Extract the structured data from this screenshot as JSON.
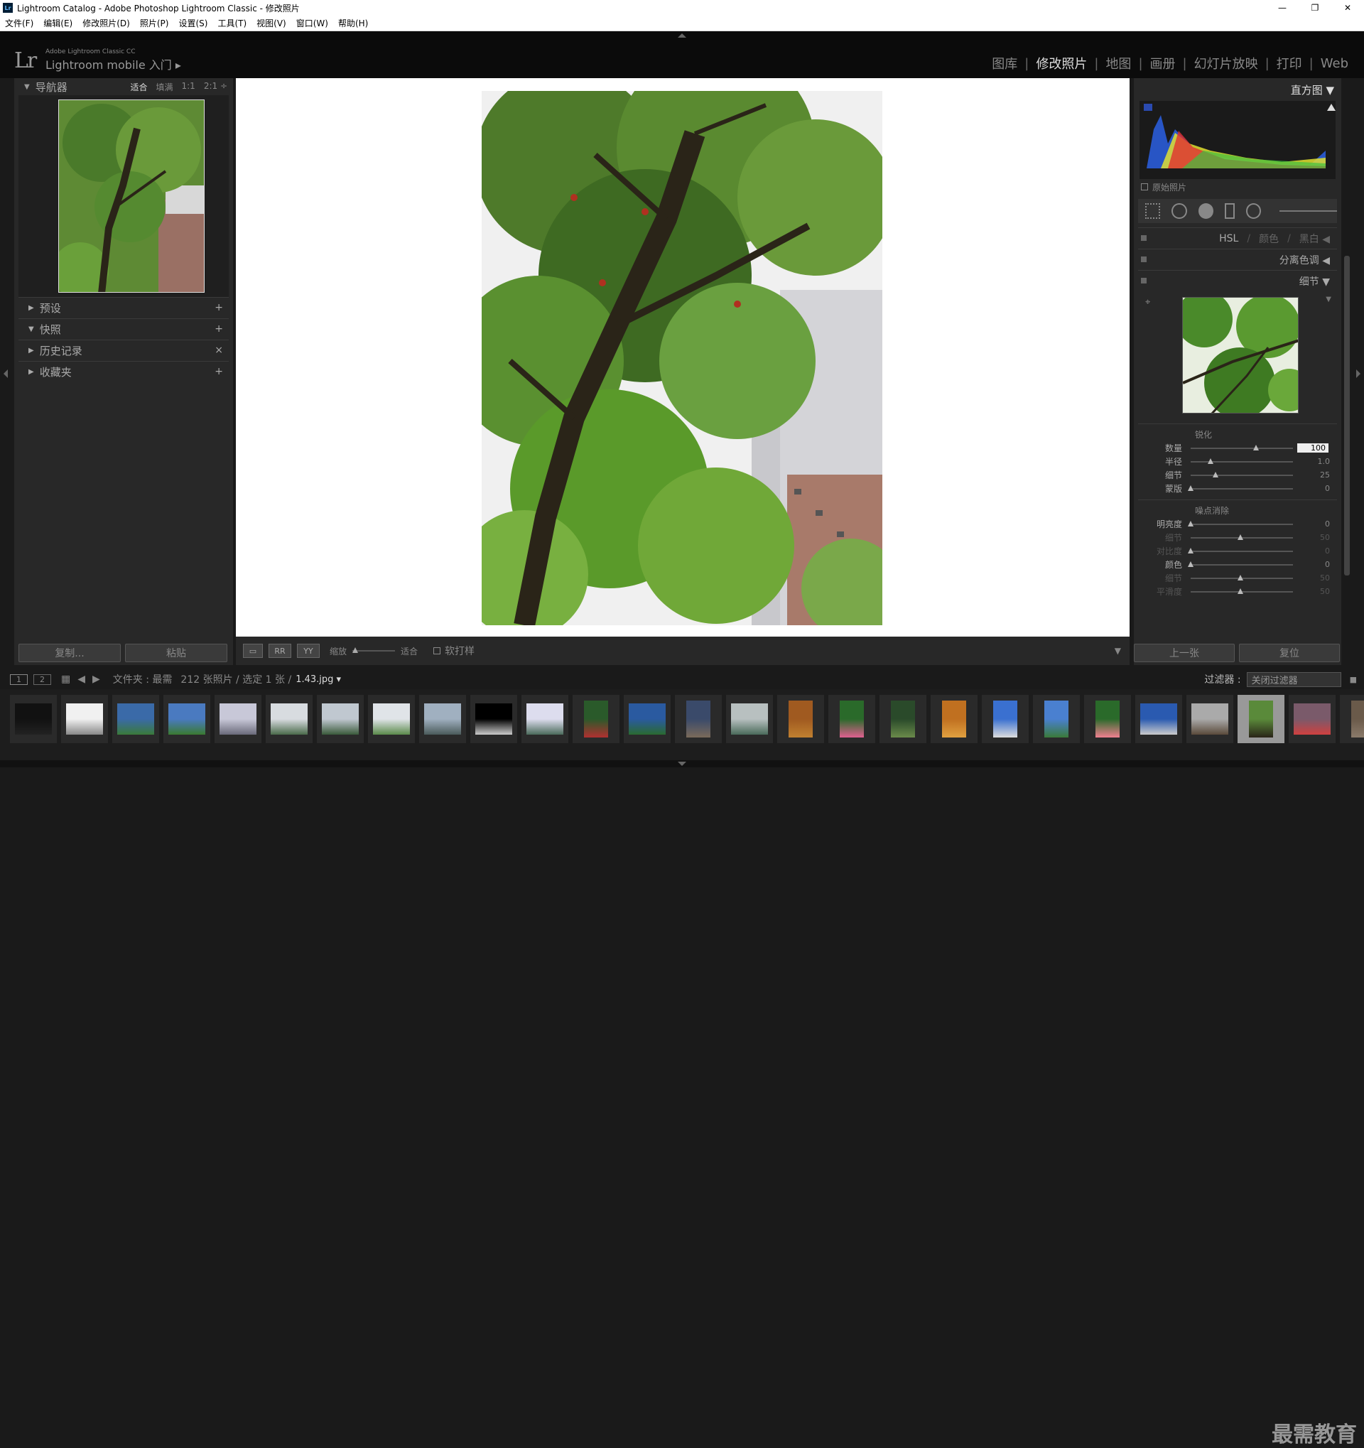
{
  "window": {
    "title": "Lightroom Catalog - Adobe Photoshop Lightroom Classic - 修改照片",
    "app_icon_text": "Lr",
    "controls": [
      "—",
      "❐",
      "✕"
    ]
  },
  "menu": [
    "文件(F)",
    "编辑(E)",
    "修改照片(D)",
    "照片(P)",
    "设置(S)",
    "工具(T)",
    "视图(V)",
    "窗口(W)",
    "帮助(H)"
  ],
  "header": {
    "logo": "Lr",
    "brand": "Adobe Lightroom Classic CC",
    "mobile": "Lightroom mobile 入门 ▸",
    "modules": [
      "图库",
      "修改照片",
      "地图",
      "画册",
      "幻灯片放映",
      "打印",
      "Web"
    ],
    "active_module": "修改照片"
  },
  "navigator": {
    "title": "导航器",
    "options": [
      "适合",
      "填满",
      "1:1",
      "2:1 ÷"
    ],
    "selected": "适合"
  },
  "left_sections": [
    {
      "label": "预设",
      "action": "+"
    },
    {
      "label": "快照",
      "action": "+"
    },
    {
      "label": "历史记录",
      "action": "×"
    },
    {
      "label": "收藏夹",
      "action": "+"
    }
  ],
  "left_buttons": {
    "copy": "复制...",
    "paste": "粘贴"
  },
  "toolbar": {
    "zoom_label": "缩放",
    "zoom_value": "适合",
    "softproof": "软打样"
  },
  "histogram": {
    "title": "直方图 ▼",
    "original_photo": "原始照片"
  },
  "right_sections": {
    "hsl": [
      "HSL",
      "/",
      "颜色",
      "/",
      "黑白 ◀"
    ],
    "split_toning": "分离色调 ◀",
    "detail": "细节 ▼"
  },
  "sharpening": {
    "title": "锐化",
    "sliders": [
      {
        "label": "数量",
        "value": "100",
        "pos": 0.66,
        "dim": false
      },
      {
        "label": "半径",
        "value": "1.0",
        "pos": 0.2,
        "dim": false
      },
      {
        "label": "细节",
        "value": "25",
        "pos": 0.25,
        "dim": false
      },
      {
        "label": "蒙版",
        "value": "0",
        "pos": 0.0,
        "dim": false
      }
    ]
  },
  "noise": {
    "title": "噪点消除",
    "sliders": [
      {
        "label": "明亮度",
        "value": "0",
        "pos": 0.0,
        "dim": false
      },
      {
        "label": "细节",
        "value": "50",
        "pos": 0.5,
        "dim": true
      },
      {
        "label": "对比度",
        "value": "0",
        "pos": 0.0,
        "dim": true
      },
      {
        "label": "颜色",
        "value": "0",
        "pos": 0.0,
        "dim": false
      },
      {
        "label": "细节",
        "value": "50",
        "pos": 0.5,
        "dim": true
      },
      {
        "label": "平滑度",
        "value": "50",
        "pos": 0.5,
        "dim": true
      }
    ]
  },
  "right_buttons": {
    "prev": "上一张",
    "reset": "复位"
  },
  "filmstrip_bar": {
    "view1": "1",
    "view2": "2",
    "source": "文件夹 : 最需",
    "count": "212 张照片 / 选定 1 张 /",
    "filename": "1.43.jpg ▾",
    "filter_label": "过滤器 :",
    "filter_value": "关闭过滤器"
  },
  "watermark": "最需教育",
  "colors": {
    "accent": "#dddddd",
    "panel": "#282828",
    "background": "#1a1a1a"
  }
}
